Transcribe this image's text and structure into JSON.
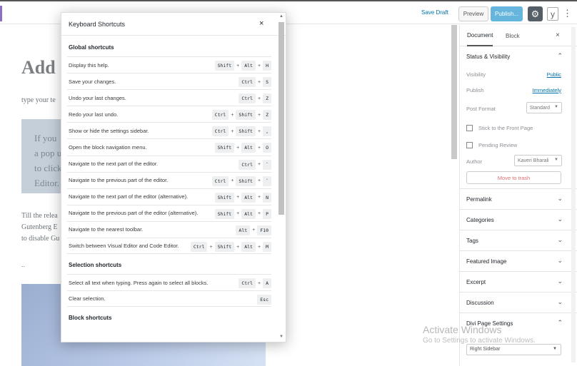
{
  "toolbar": {
    "save_draft": "Save Draft",
    "preview": "Preview",
    "publish": "Publish...",
    "settings_icon": "gear-icon",
    "yoast_icon": "y",
    "more_icon": "⋮"
  },
  "editor": {
    "title": "Add ",
    "paragraph1": "type your te",
    "quote_lines": [
      "If you",
      "a pop u",
      "to click",
      "Editor."
    ],
    "paragraph2_lines": [
      "Till the relea",
      "Gutenberg E",
      "to disable Gu"
    ],
    "dots": ".."
  },
  "modal": {
    "title": "Keyboard Shortcuts",
    "close": "×",
    "sections": [
      {
        "title": "Global shortcuts",
        "rows": [
          {
            "desc": "Display this help.",
            "keys": [
              "Shift",
              "Alt",
              "H"
            ]
          },
          {
            "desc": "Save your changes.",
            "keys": [
              "Ctrl",
              "S"
            ]
          },
          {
            "desc": "Undo your last changes.",
            "keys": [
              "Ctrl",
              "Z"
            ]
          },
          {
            "desc": "Redo your last undo.",
            "keys": [
              "Ctrl",
              "Shift",
              "Z"
            ]
          },
          {
            "desc": "Show or hide the settings sidebar.",
            "keys": [
              "Ctrl",
              "Shift",
              ","
            ]
          },
          {
            "desc": "Open the block navigation menu.",
            "keys": [
              "Shift",
              "Alt",
              "O"
            ]
          },
          {
            "desc": "Navigate to the next part of the editor.",
            "keys": [
              "Ctrl",
              "`"
            ]
          },
          {
            "desc": "Navigate to the previous part of the editor.",
            "keys": [
              "Ctrl",
              "Shift",
              "`"
            ]
          },
          {
            "desc": "Navigate to the next part of the editor (alternative).",
            "keys": [
              "Shift",
              "Alt",
              "N"
            ]
          },
          {
            "desc": "Navigate to the previous part of the editor (alternative).",
            "keys": [
              "Shift",
              "Alt",
              "P"
            ]
          },
          {
            "desc": "Navigate to the nearest toolbar.",
            "keys": [
              "Alt",
              "F10"
            ]
          },
          {
            "desc": "Switch between Visual Editor and Code Editor.",
            "keys": [
              "Ctrl",
              "Shift",
              "Alt",
              "M"
            ]
          }
        ]
      },
      {
        "title": "Selection shortcuts",
        "rows": [
          {
            "desc": "Select all text when typing. Press again to select all blocks.",
            "keys": [
              "Ctrl",
              "A"
            ]
          },
          {
            "desc": "Clear selection.",
            "keys": [
              "Esc"
            ]
          }
        ]
      },
      {
        "title": "Block shortcuts",
        "rows": []
      }
    ]
  },
  "sidebar": {
    "tab_document": "Document",
    "tab_block": "Block",
    "close": "×",
    "status_visibility": {
      "title": "Status & Visibility",
      "visibility_label": "Visibility",
      "visibility_value": "Public",
      "publish_label": "Publish",
      "publish_value": "Immediately",
      "post_format_label": "Post Format",
      "post_format_value": "Standard",
      "stick_label": "Stick to the Front Page",
      "pending_label": "Pending Review",
      "author_label": "Author",
      "author_value": "Kaveri Bharali",
      "trash": "Move to trash"
    },
    "panels": [
      "Permalink",
      "Categories",
      "Tags",
      "Featured Image",
      "Excerpt",
      "Discussion",
      "Divi Page Settings"
    ],
    "divi_select": "Right Sidebar"
  },
  "watermark": {
    "line1": "Activate Windows",
    "line2": "Go to Settings to activate Windows."
  }
}
